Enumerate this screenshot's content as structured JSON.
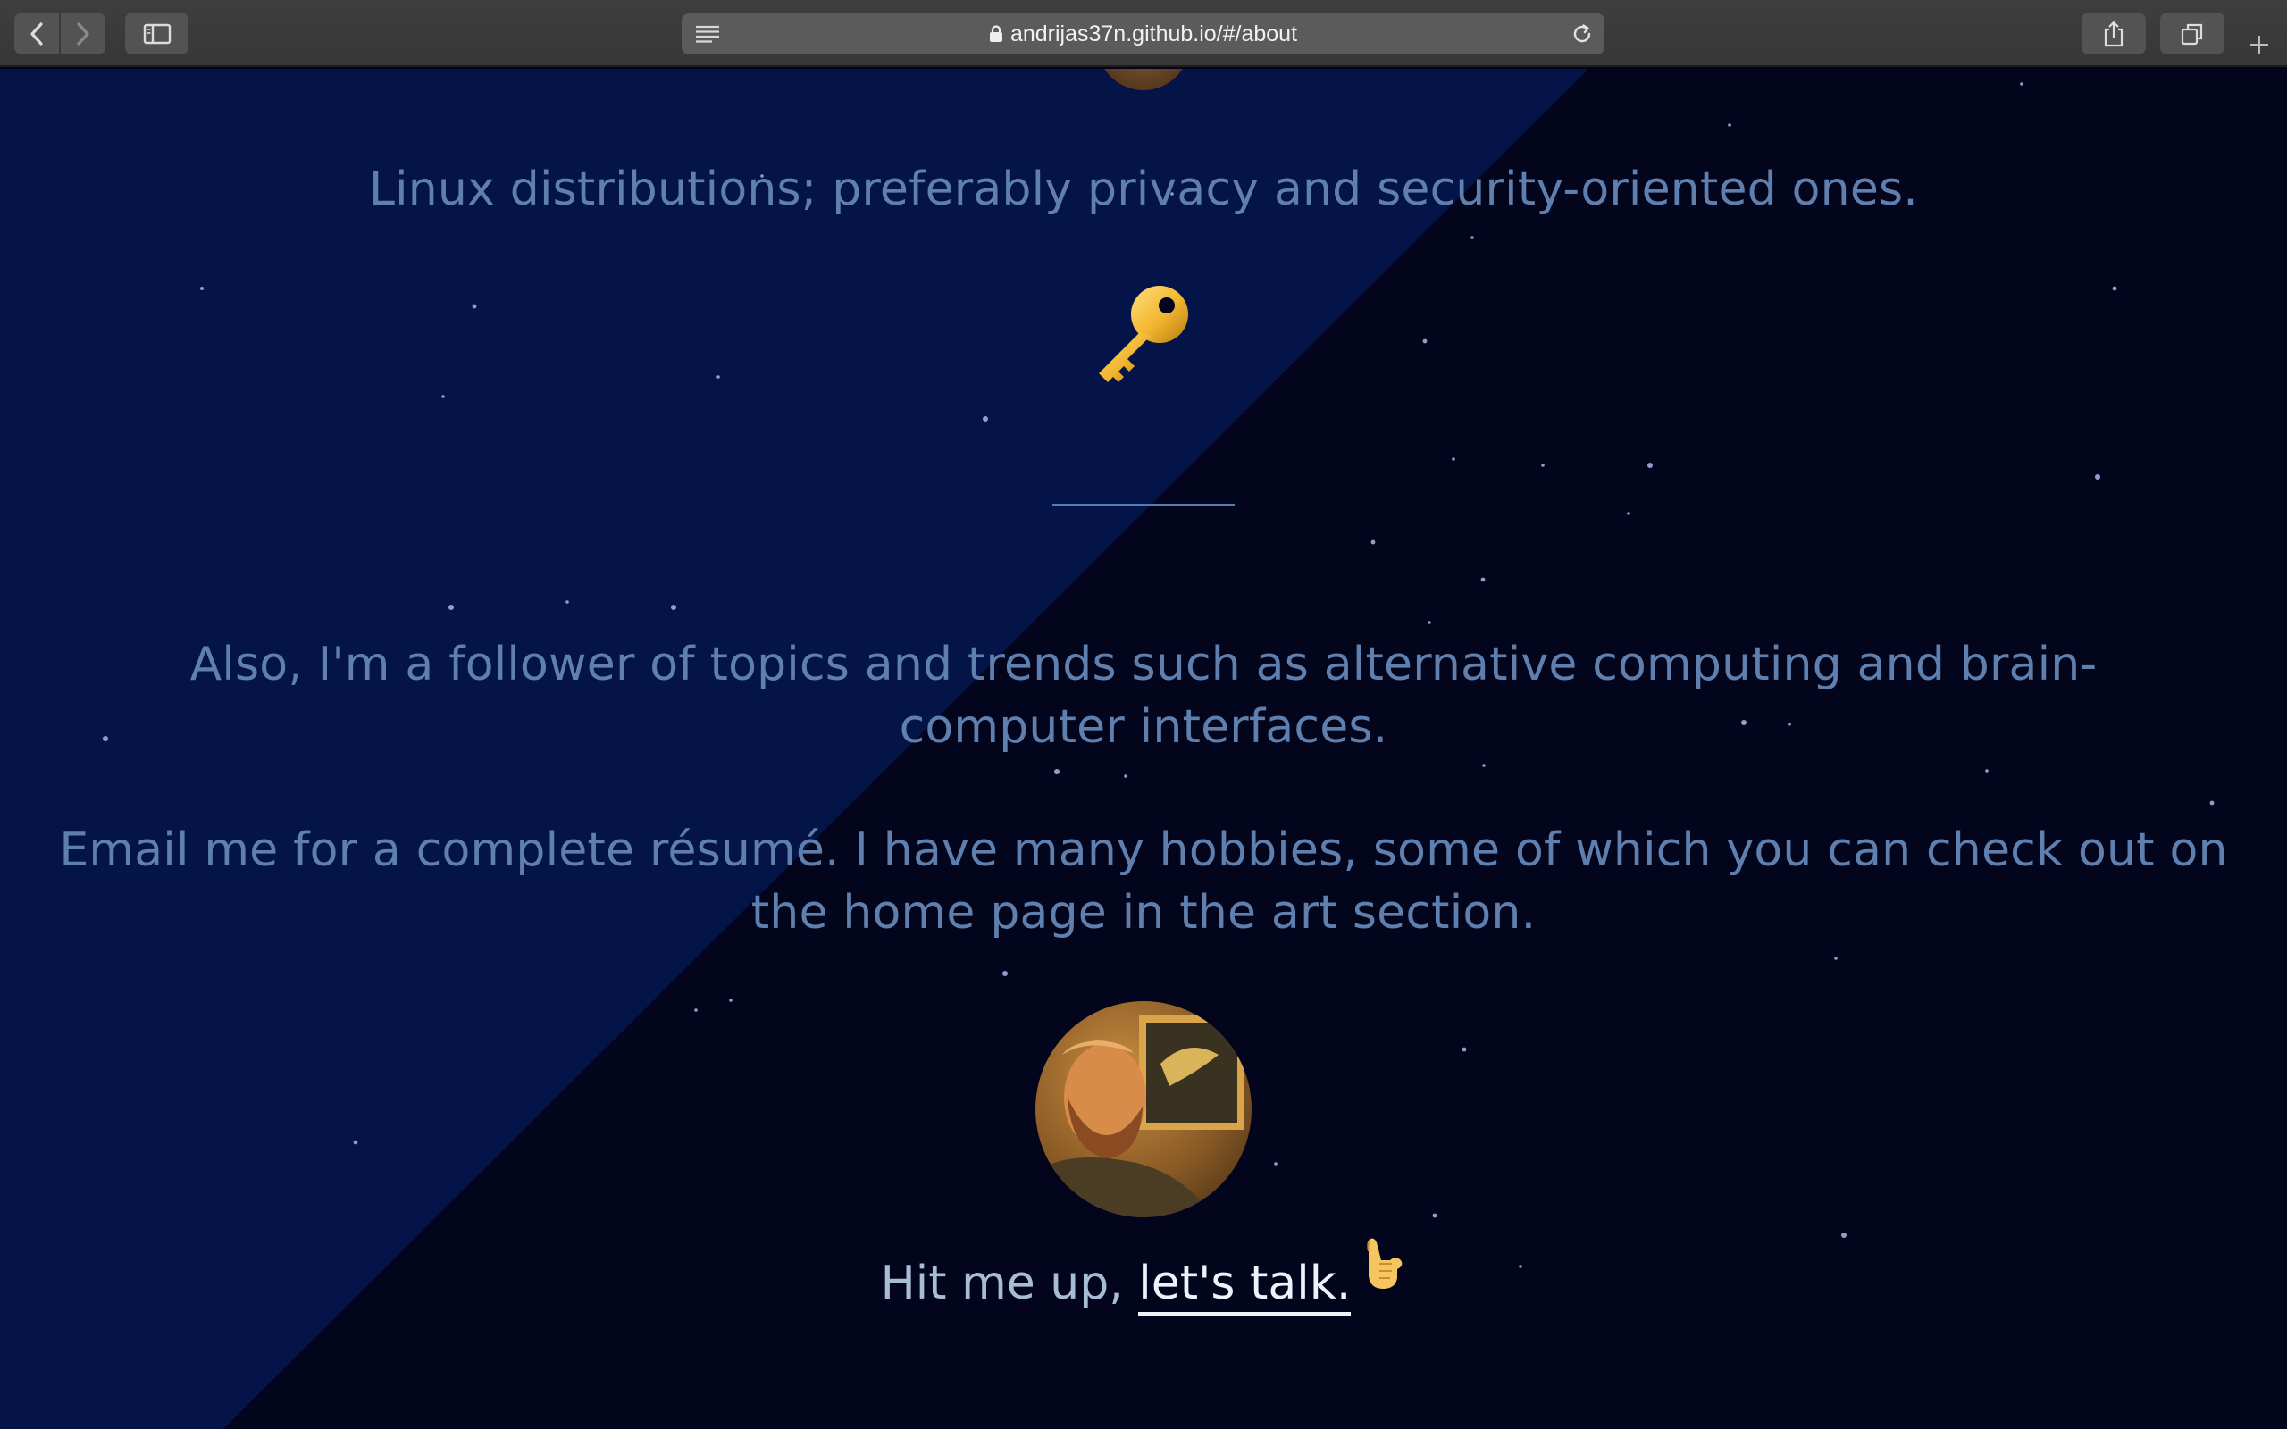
{
  "browser": {
    "url": "andrijas37n.github.io/#/about",
    "buttons": {
      "back": "back",
      "forward": "forward",
      "sidebar": "show sidebar",
      "share": "share",
      "tabs": "show all tabs",
      "new_tab": "new tab"
    }
  },
  "about": {
    "linux_line": "Linux distributions; preferably privacy and security-oriented ones.",
    "key_icon": "key-icon",
    "also_text": "Also, I'm a follower of topics and trends such as alternative computing and brain-computer interfaces.",
    "email_text": "Email me for a complete résumé. I have many hobbies, some of which you can check out on the home page in the art section.",
    "cta_prefix": "Hit me up, ",
    "cta_link": "let's talk.",
    "cta_icon": "call-me-hand-icon"
  },
  "colors": {
    "background_dark": "#03051c",
    "background_diagonal": "#041348",
    "body_text": "#5f80ae",
    "cta_text": "#a9bcd6",
    "link": "#eef2fa",
    "divider": "#4f7db5"
  }
}
